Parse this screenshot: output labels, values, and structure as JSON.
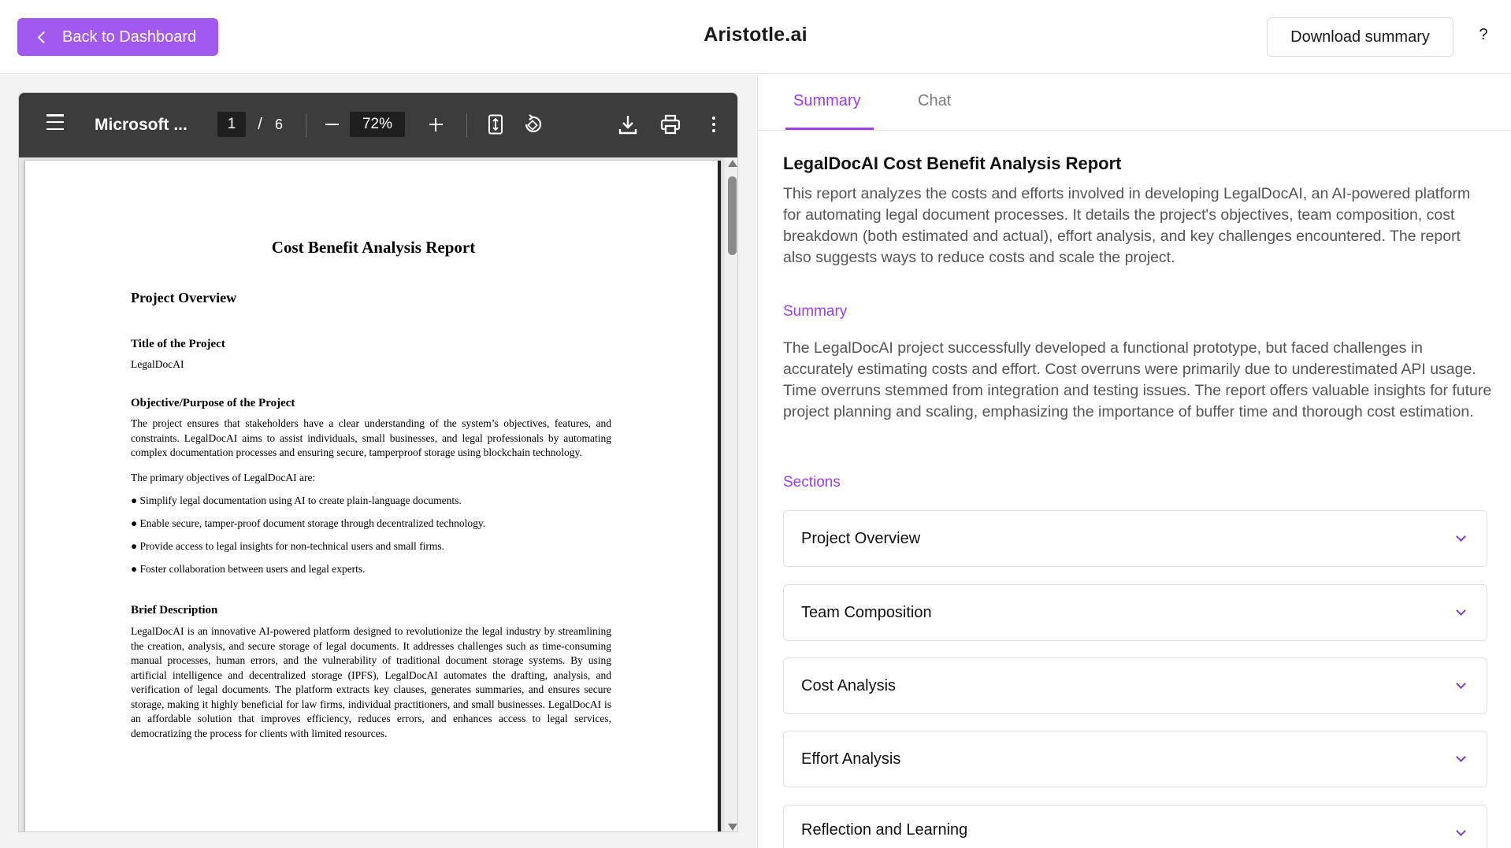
{
  "header": {
    "back_label": "Back to Dashboard",
    "app_title": "Aristotle.ai",
    "download_label": "Download summary",
    "help_label": "?"
  },
  "viewer": {
    "doc_name": "Microsoft ...",
    "page_current": "1",
    "page_sep": "/",
    "page_total": "6",
    "zoom": "72%",
    "icons": [
      "menu-icon",
      "zoom-out-icon",
      "zoom-in-icon",
      "fit-page-icon",
      "rotate-icon",
      "download-icon",
      "print-icon",
      "more-options-icon"
    ]
  },
  "document": {
    "title": "Cost Benefit Analysis Report",
    "project_overview": "Project Overview",
    "title_of_project_heading": "Title of the Project",
    "title_of_project_value": "LegalDocAI",
    "objective_heading": "Objective/Purpose of the Project",
    "objective_text": "The project ensures that stakeholders have a clear understanding of the system’s objectives, features, and constraints. LegalDocAI aims to assist individuals, small businesses, and legal professionals by automating complex documentation processes and ensuring secure, tamperproof storage using blockchain technology.",
    "primary_objectives_intro": "The primary objectives of LegalDocAI are:",
    "bullets": [
      "● Simplify legal documentation using AI to create plain-language documents.",
      "● Enable secure, tamper-proof document storage through decentralized technology.",
      "● Provide access to legal insights for non-technical users and small firms.",
      "● Foster collaboration between users and legal experts."
    ],
    "brief_heading": "Brief Description",
    "brief_text": "LegalDocAI is an innovative AI-powered platform designed to revolutionize the legal industry by streamlining the creation, analysis, and secure storage of legal documents. It addresses challenges such as time-consuming manual processes, human errors, and the vulnerability of traditional document storage systems. By using artificial intelligence and decentralized storage (IPFS), LegalDocAI automates the drafting, analysis, and verification of legal documents. The platform extracts key clauses, generates summaries, and ensures secure storage, making it highly beneficial for law firms, individual practitioners, and small businesses. LegalDocAI is an affordable solution that improves efficiency, reduces errors, and enhances access to legal services, democratizing the process for clients with limited resources."
  },
  "panel": {
    "tabs": [
      {
        "label": "Summary",
        "active": true
      },
      {
        "label": "Chat",
        "active": false
      }
    ],
    "report_title": "LegalDocAI Cost Benefit Analysis Report",
    "report_desc": "This report analyzes the costs and efforts involved in developing LegalDocAI, an AI-powered platform for automating legal document processes. It details the project's objectives, team composition, cost breakdown (both estimated and actual), effort analysis, and key challenges encountered. The report also suggests ways to reduce costs and scale the project.",
    "summary_label": "Summary",
    "summary_text": "The LegalDocAI project successfully developed a functional prototype, but faced challenges in accurately estimating costs and effort. Cost overruns were primarily due to underestimated API usage. Time overruns stemmed from integration and testing issues. The report offers valuable insights for future project planning and scaling, emphasizing the importance of buffer time and thorough cost estimation.",
    "sections_label": "Sections",
    "sections": [
      {
        "label": "Project Overview"
      },
      {
        "label": "Team Composition"
      },
      {
        "label": "Cost Analysis"
      },
      {
        "label": "Effort Analysis"
      },
      {
        "label": "Reflection and Learning"
      }
    ]
  },
  "colors": {
    "accent": "#a259f0",
    "accent_text": "#9a3ef0",
    "toolbar": "#3c3c3c"
  }
}
